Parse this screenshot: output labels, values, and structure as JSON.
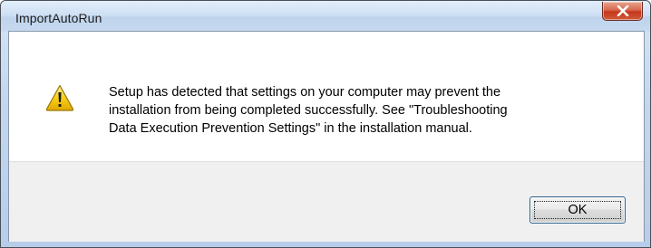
{
  "window": {
    "title": "ImportAutoRun",
    "close_icon": "close-icon"
  },
  "dialog": {
    "icon": "warning-icon",
    "message": "Setup has detected that settings on your computer may prevent the\ninstallation from being completed successfully. See \"Troubleshooting\nData Execution Prevention Settings\" in the installation manual."
  },
  "buttons": {
    "ok_label": "OK"
  },
  "colors": {
    "close_button": "#c4381c",
    "warning_fill": "#f5c400",
    "button_border": "#2c628b"
  }
}
